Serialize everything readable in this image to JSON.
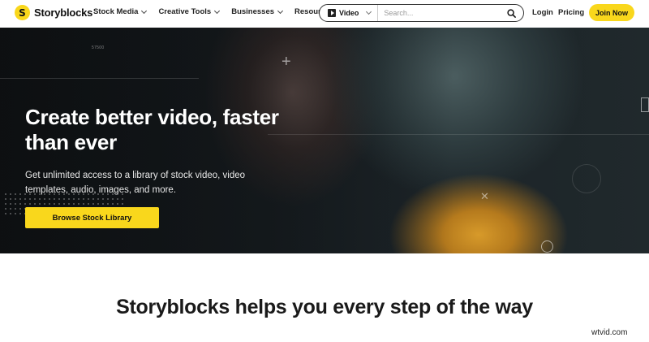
{
  "brand": {
    "name": "Storyblocks",
    "mark": "S",
    "accent": "#f9d71c"
  },
  "nav": {
    "items": [
      {
        "label": "Stock Media"
      },
      {
        "label": "Creative Tools"
      },
      {
        "label": "Businesses"
      },
      {
        "label": "Resources"
      }
    ],
    "search": {
      "type_label": "Video",
      "placeholder": "Search..."
    },
    "login": "Login",
    "pricing": "Pricing",
    "join": "Join Now"
  },
  "hero": {
    "counter": "57500",
    "title": "Create better video, faster than ever",
    "subtitle": "Get unlimited access to a library of stock video, video templates, audio, images, and more.",
    "cta": "Browse Stock Library"
  },
  "section": {
    "title": "Storyblocks helps you every step of the way"
  },
  "watermark": "wtvid.com"
}
